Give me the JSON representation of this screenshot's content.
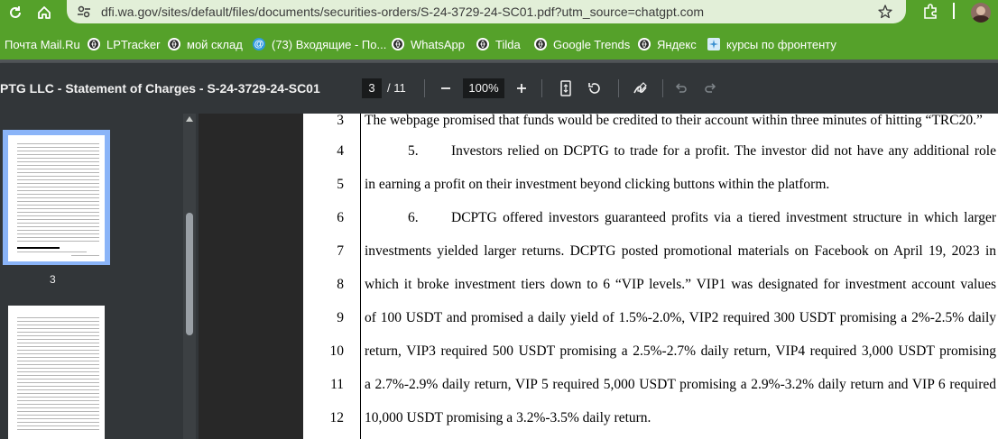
{
  "browser": {
    "url": "dfi.wa.gov/sites/default/files/documents/securities-orders/S-24-3729-24-SC01.pdf?utm_source=chatgpt.com",
    "accent_color": "#55a12a"
  },
  "bookmarks": [
    {
      "label": "Почта Mail.Ru",
      "icon": "mailru-icon"
    },
    {
      "label": "LPTracker",
      "icon": "globe-icon"
    },
    {
      "label": "мой склад",
      "icon": "globe-icon"
    },
    {
      "label": "(73) Входящие - По...",
      "icon": "at-icon"
    },
    {
      "label": "WhatsApp",
      "icon": "globe-icon"
    },
    {
      "label": "Tilda",
      "icon": "globe-icon"
    },
    {
      "label": "Google Trends",
      "icon": "globe-icon"
    },
    {
      "label": "Яндекс",
      "icon": "globe-icon"
    },
    {
      "label": "курсы по фронтенту",
      "icon": "puzzle-icon"
    }
  ],
  "pdf_toolbar": {
    "title": "PTG LLC - Statement of Charges - S-24-3729-24-SC01",
    "current_page": "3",
    "total_pages": "/ 11",
    "zoom": "100%"
  },
  "sidebar": {
    "thumb_label": "3"
  },
  "document": {
    "lines": [
      {
        "num": "3",
        "text": "The webpage promised that funds would be credited to their account within three minutes of hitting “TRC20.”",
        "para": ""
      },
      {
        "num": "4",
        "text": "Investors relied on DCPTG to trade for a profit. The investor did not have any additional role",
        "para": "5."
      },
      {
        "num": "5",
        "text": "in earning a profit on their investment beyond clicking buttons within the platform.",
        "para": ""
      },
      {
        "num": "6",
        "text": "DCPTG offered investors guaranteed profits via a tiered investment structure in which larger",
        "para": "6."
      },
      {
        "num": "7",
        "text": "investments yielded larger returns. DCPTG posted promotional materials on Facebook on April 19, 2023 in",
        "para": ""
      },
      {
        "num": "8",
        "text": "which it broke investment tiers down to 6 “VIP levels.” VIP1 was designated for investment account values",
        "para": ""
      },
      {
        "num": "9",
        "text": "of 100 USDT and promised a daily yield of 1.5%-2.0%, VIP2 required 300 USDT promising a 2%-2.5% daily",
        "para": ""
      },
      {
        "num": "10",
        "text": "return, VIP3 required 500 USDT promising a 2.5%-2.7% daily return, VIP4 required 3,000 USDT promising",
        "para": ""
      },
      {
        "num": "11",
        "text": "a 2.7%-2.9% daily return, VIP 5 required 5,000 USDT promising a 2.9%-3.2% daily return and VIP 6 required",
        "para": ""
      },
      {
        "num": "12",
        "text": "10,000 USDT promising a 3.2%-3.5% daily return.",
        "para": ""
      }
    ]
  }
}
